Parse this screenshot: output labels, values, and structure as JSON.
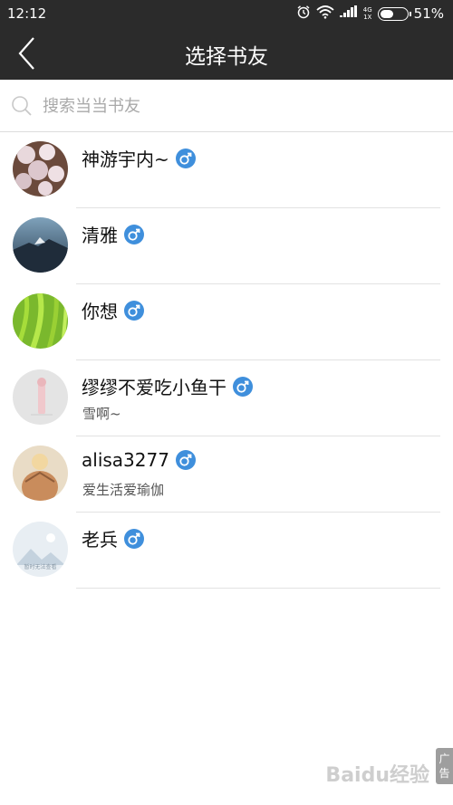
{
  "status_bar": {
    "time": "12:12",
    "network_top": "4G",
    "network_bottom": "1X",
    "battery_text": "51%",
    "battery_level": 0.51,
    "icons": [
      "alarm-icon",
      "wifi-icon",
      "signal-icon",
      "battery-icon"
    ]
  },
  "nav": {
    "title": "选择书友",
    "back_icon": "chevron-left-icon"
  },
  "search": {
    "placeholder": "搜索当当书友",
    "value": ""
  },
  "friends": [
    {
      "name": "神游宇内~",
      "subtitle": "",
      "gender": "male"
    },
    {
      "name": "清雅",
      "subtitle": "",
      "gender": "male"
    },
    {
      "name": "你想",
      "subtitle": "",
      "gender": "male"
    },
    {
      "name": "缪缪不爱吃小鱼干",
      "subtitle": "雪啊~",
      "gender": "male"
    },
    {
      "name": "alisa3277",
      "subtitle": "爱生活爱瑜伽",
      "gender": "male"
    },
    {
      "name": "老兵",
      "subtitle": "",
      "gender": "male"
    }
  ],
  "default_avatar_caption": "暂时无法查看",
  "ad_label": "广告",
  "watermark": "Baidu经验",
  "colors": {
    "header_bg": "#2b2b2b",
    "gender_badge": "#3f8fdc",
    "divider": "#e2e2e2"
  }
}
